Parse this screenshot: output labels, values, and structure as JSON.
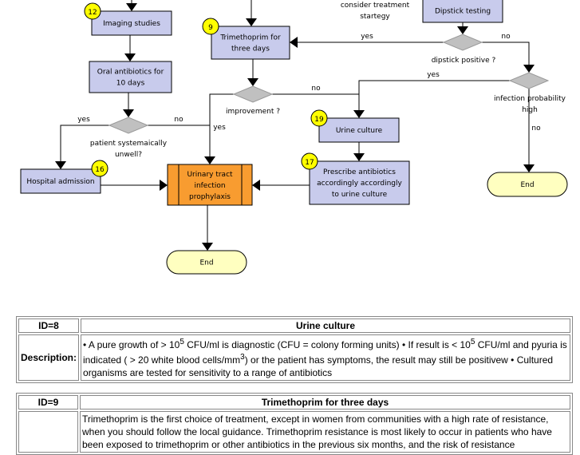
{
  "colors": {
    "process": "#c8cbec",
    "decision": "#c0c0c0",
    "subprocess": "#f89c30",
    "terminal": "#ffffc0",
    "badge": "#ffff00"
  },
  "nodes": {
    "imaging": {
      "label": [
        "Imaging studies"
      ],
      "badge": "12"
    },
    "oral": {
      "label": [
        "Oral antibiotics for",
        "10 days"
      ]
    },
    "patient_decision": {
      "label": [
        "patient systemaically",
        "unwell?"
      ],
      "yes": "yes",
      "no": "no"
    },
    "hospital": {
      "label": [
        "Hospital admission"
      ],
      "badge": "16"
    },
    "trimethoprim": {
      "label": [
        "Trimethoprim for",
        "three days"
      ],
      "badge": "9"
    },
    "improvement": {
      "label": [
        "improvement ?"
      ],
      "yes": "yes",
      "no": "no"
    },
    "uti": {
      "label": [
        "Urinary tract",
        "infection",
        "prophylaxis"
      ]
    },
    "end1": {
      "label": [
        "End"
      ]
    },
    "consider": {
      "label": [
        "consider treatment",
        "startegy"
      ]
    },
    "dipstick": {
      "label": [
        "Dipstick testing"
      ]
    },
    "dipstick_decision": {
      "label": [
        "dipstick positive ?"
      ],
      "yes": "yes",
      "no": "no"
    },
    "infection_decision": {
      "label": [
        "infection probability",
        "high"
      ],
      "yes": "yes",
      "no": "no"
    },
    "urine": {
      "label": [
        "Urine culture"
      ],
      "badge": "19"
    },
    "prescribe": {
      "label": [
        "Prescribe antibiotics",
        "accordingly accordingly",
        "to urine culture"
      ],
      "badge": "17"
    },
    "end2": {
      "label": [
        "End"
      ]
    }
  },
  "tables": [
    {
      "id": "ID=8",
      "title": "Urine culture",
      "desc_label": "Description:",
      "desc_parts": [
        "• A pure growth of > 10",
        "5",
        " CFU/ml is diagnostic (CFU = colony forming units) • If result is < 10",
        "5",
        " CFU/ml and pyuria is indicated ( > 20 white blood cells/mm",
        "3",
        ") or the patient has symptoms, the result may still be positivew • Cultured organisms are tested for sensitivity to a range of antibiotics"
      ]
    },
    {
      "id": "ID=9",
      "title": "Trimethoprim for three days",
      "desc_label": "",
      "desc": "Trimethoprim is the first choice of treatment, except in women from communities with a high rate of resistance, when you should follow the local guidance. Trimethoprim resistance is most likely to occur in patients who have been exposed to trimethoprim or other antibiotics in the previous six months, and the risk of resistance"
    }
  ]
}
